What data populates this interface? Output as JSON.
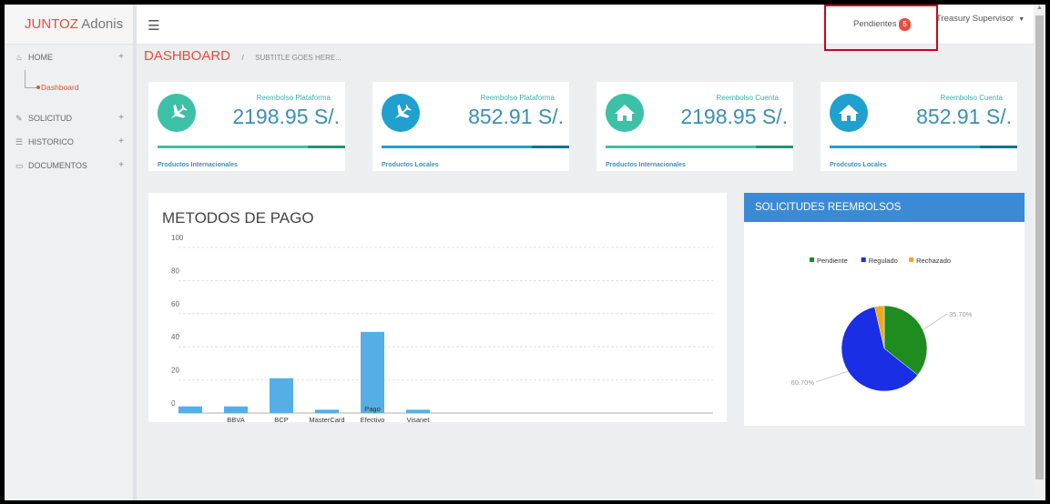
{
  "brand": {
    "name_red": "JUNTOZ",
    "name_grey": " Adonis"
  },
  "topbar": {
    "pendientes_label": "Pendientes",
    "pendientes_count": "5",
    "user_label": "Treasury Supervisor"
  },
  "sidebar": {
    "home": "HOME",
    "dashboard": "Dashboard",
    "items": [
      {
        "label": "SOLICITUD",
        "icon": "edit-icon"
      },
      {
        "label": "HISTORICO",
        "icon": "list-icon"
      },
      {
        "label": "DOCUMENTOS",
        "icon": "folder-icon"
      }
    ]
  },
  "breadcrumb": {
    "title": "DASHBOARD",
    "sep": "/",
    "subtitle": "SUBTITLE GOES HERE..."
  },
  "cards": [
    {
      "label": "Reembolso Plataforma",
      "value": "2198.95 S/.",
      "footer": "Productos Internacionales",
      "icon": "plane-icon",
      "color": "#3cc0a6"
    },
    {
      "label": "Reembolso Plataforma",
      "value": "852.91 S/.",
      "footer": "Productos Locales",
      "icon": "plane-icon",
      "color": "#1fa0cf"
    },
    {
      "label": "Reembolso Cuenta",
      "value": "2198.95 S/.",
      "footer": "Productos Internacionales",
      "icon": "home-icon",
      "color": "#3cc0a6"
    },
    {
      "label": "Reembolso Cuenta",
      "value": "852.91 S/.",
      "footer": "Prodcutos Locales",
      "icon": "home-icon",
      "color": "#1fa0cf"
    }
  ],
  "bar_panel": {
    "title": "METODOS DE PAGO"
  },
  "pie_panel": {
    "title": "SOLICITUDES REEMBOLSOS"
  },
  "chart_data": [
    {
      "type": "bar",
      "title": "METODOS DE PAGO",
      "categories": [
        "",
        "BBVA",
        "BCP",
        "MasterCard",
        "Pago Efectivo",
        "Visanet"
      ],
      "values": [
        4,
        4,
        21,
        2,
        49,
        2
      ],
      "ylim": [
        0,
        100
      ],
      "yticks": [
        0,
        20,
        40,
        60,
        80,
        100
      ],
      "grid": true,
      "color": "#55aee6"
    },
    {
      "type": "pie",
      "title": "SOLICITUDES REEMBOLSOS",
      "legend_position": "top",
      "slices": [
        {
          "name": "Pendiente",
          "value": 35.7,
          "label": "35.70%",
          "color": "#1e8c1e"
        },
        {
          "name": "Regulado",
          "value": 60.7,
          "label": "60.70%",
          "color": "#1a2ee6"
        },
        {
          "name": "Rechazado",
          "value": 3.6,
          "label": "",
          "color": "#f0a81e"
        }
      ]
    }
  ]
}
